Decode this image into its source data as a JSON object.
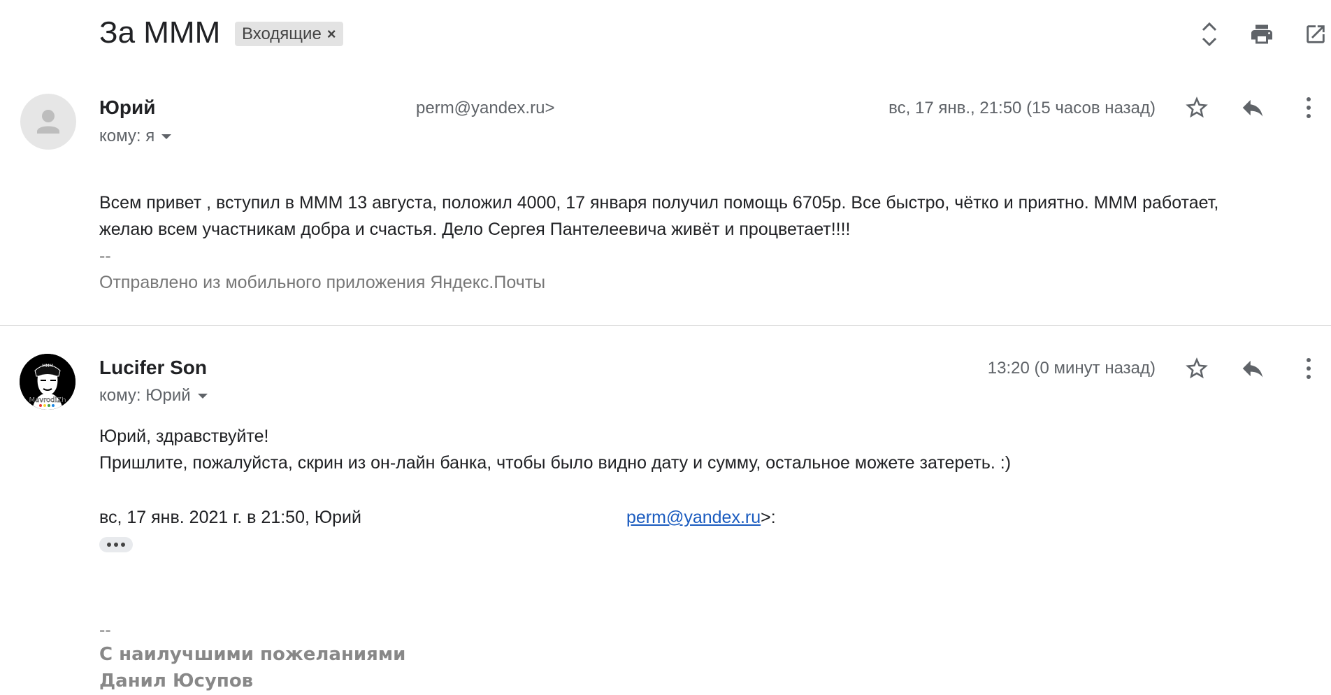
{
  "thread": {
    "subject": "За МММ",
    "label": "Входящие"
  },
  "toolbar_icons": [
    "expand-collapse-icon",
    "print-icon",
    "open-in-new-window-icon"
  ],
  "messages": [
    {
      "sender": "Юрий",
      "email_partial": "perm@yandex.ru>",
      "to": "кому: я",
      "date": "вс, 17 янв., 21:50 (15 часов назад)",
      "body": [
        "Всем привет , вступил в МММ 13 августа, положил 4000,  17 января получил помощь  6705р. Все быстро, чётко и приятно. МММ работает,",
        "желаю всем участникам добра и счастья. Дело Сергея Пантелеевича живёт и процветает!!!!"
      ],
      "sig_dash": "--",
      "sig": "Отправлено из мобильного приложения Яндекс.Почты"
    },
    {
      "sender": "Lucifer Son",
      "avatar_text": "MavrodiZh",
      "to": "кому: Юрий",
      "date": "13:20 (0 минут назад)",
      "body": [
        "Юрий, здравствуйте!",
        "Пришлите, пожалуйста, скрин из он-лайн банка, чтобы было видно дату и сумму, остальное можете затереть. :)"
      ],
      "quote_prefix": "вс, 17 янв. 2021 г. в 21:50, Юрий",
      "quote_email": "perm@yandex.ru",
      "quote_suffix": ">:",
      "sig_dash": "--",
      "sig_line1": "С наилучшими пожеланиями",
      "sig_line2": "Данил Юсупов"
    }
  ]
}
